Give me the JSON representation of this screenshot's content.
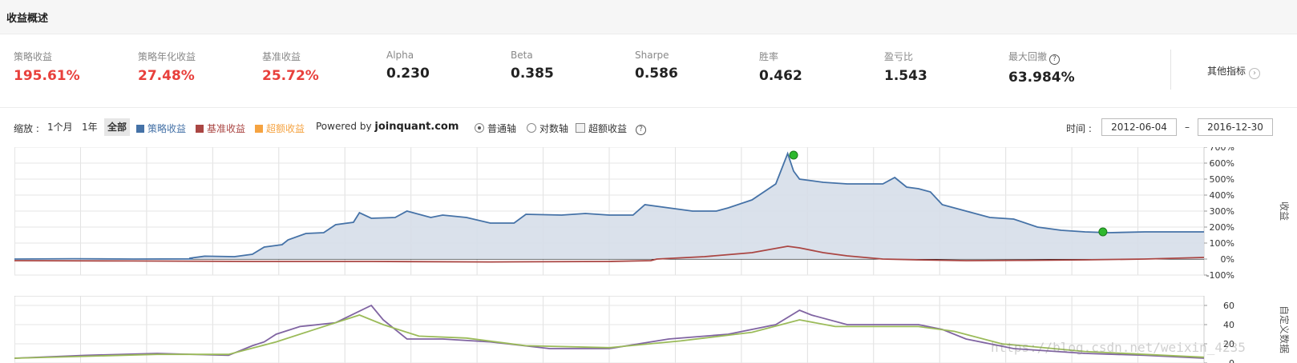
{
  "header": {
    "title": "收益概述"
  },
  "metrics": [
    {
      "label": "策略收益",
      "value": "195.61%",
      "color": "red"
    },
    {
      "label": "策略年化收益",
      "value": "27.48%",
      "color": "red"
    },
    {
      "label": "基准收益",
      "value": "25.72%",
      "color": "red"
    },
    {
      "label": "Alpha",
      "value": "0.230",
      "color": "dark"
    },
    {
      "label": "Beta",
      "value": "0.385",
      "color": "dark"
    },
    {
      "label": "Sharpe",
      "value": "0.586",
      "color": "dark"
    },
    {
      "label": "胜率",
      "value": "0.462",
      "color": "dark"
    },
    {
      "label": "盈亏比",
      "value": "1.543",
      "color": "dark"
    },
    {
      "label": "最大回撤",
      "value": "63.984%",
      "color": "dark",
      "help": "?"
    }
  ],
  "more": {
    "label": "其他指标",
    "icon": "chevron-right-icon"
  },
  "toolbar": {
    "zoom_label": "缩放 :",
    "zoom_options": [
      "1个月",
      "1年",
      "全部"
    ],
    "zoom_selected": "全部",
    "legend": [
      {
        "label": "策略收益",
        "color": "#4572a7"
      },
      {
        "label": "基准收益",
        "color": "#aa4643"
      },
      {
        "label": "超额收益",
        "color": "#f5a341"
      }
    ],
    "powered_prefix": "Powered by",
    "powered_brand": "joinquant.com",
    "axis_normal": "普通轴",
    "axis_log": "对数轴",
    "excess_toggle": "超额收益",
    "help": "?",
    "time_label": "时间 :",
    "date_from": "2012-06-04",
    "date_sep": "–",
    "date_to": "2016-12-30"
  },
  "chart_data": [
    {
      "type": "area",
      "ylabel": "收益",
      "ylim": [
        -100,
        700
      ],
      "yticks": [
        700,
        600,
        500,
        400,
        300,
        200,
        100,
        0,
        -100
      ],
      "ytick_labels": [
        "700%",
        "600%",
        "500%",
        "400%",
        "300%",
        "200%",
        "100%",
        "0%",
        "-100%"
      ],
      "grid": true,
      "series": [
        {
          "name": "策略收益",
          "color": "#4572a7",
          "fill": "#d6dee9",
          "points": [
            [
              0,
              0
            ],
            [
              0.05,
              2
            ],
            [
              0.1,
              0
            ],
            [
              0.15,
              1
            ],
            [
              0.147,
              5
            ],
            [
              0.16,
              18
            ],
            [
              0.185,
              15
            ],
            [
              0.2,
              30
            ],
            [
              0.21,
              75
            ],
            [
              0.225,
              90
            ],
            [
              0.23,
              120
            ],
            [
              0.245,
              160
            ],
            [
              0.26,
              165
            ],
            [
              0.27,
              215
            ],
            [
              0.285,
              230
            ],
            [
              0.29,
              290
            ],
            [
              0.3,
              255
            ],
            [
              0.32,
              260
            ],
            [
              0.33,
              300
            ],
            [
              0.35,
              260
            ],
            [
              0.36,
              275
            ],
            [
              0.38,
              260
            ],
            [
              0.4,
              225
            ],
            [
              0.42,
              225
            ],
            [
              0.43,
              280
            ],
            [
              0.46,
              275
            ],
            [
              0.48,
              285
            ],
            [
              0.5,
              275
            ],
            [
              0.52,
              275
            ],
            [
              0.53,
              340
            ],
            [
              0.55,
              320
            ],
            [
              0.57,
              300
            ],
            [
              0.59,
              300
            ],
            [
              0.6,
              320
            ],
            [
              0.62,
              370
            ],
            [
              0.64,
              470
            ],
            [
              0.65,
              660
            ],
            [
              0.655,
              550
            ],
            [
              0.66,
              500
            ],
            [
              0.68,
              480
            ],
            [
              0.7,
              470
            ],
            [
              0.73,
              470
            ],
            [
              0.74,
              510
            ],
            [
              0.75,
              450
            ],
            [
              0.76,
              440
            ],
            [
              0.77,
              420
            ],
            [
              0.78,
              340
            ],
            [
              0.8,
              300
            ],
            [
              0.82,
              260
            ],
            [
              0.84,
              250
            ],
            [
              0.86,
              200
            ],
            [
              0.88,
              180
            ],
            [
              0.9,
              170
            ],
            [
              0.92,
              165
            ],
            [
              0.95,
              170
            ],
            [
              1.0,
              170
            ]
          ]
        },
        {
          "name": "基准收益",
          "color": "#aa4643",
          "points": [
            [
              0,
              -10
            ],
            [
              0.1,
              -12
            ],
            [
              0.2,
              -15
            ],
            [
              0.3,
              -15
            ],
            [
              0.4,
              -18
            ],
            [
              0.5,
              -15
            ],
            [
              0.535,
              -10
            ],
            [
              0.54,
              0
            ],
            [
              0.58,
              15
            ],
            [
              0.62,
              40
            ],
            [
              0.65,
              80
            ],
            [
              0.66,
              70
            ],
            [
              0.68,
              40
            ],
            [
              0.7,
              20
            ],
            [
              0.73,
              0
            ],
            [
              0.76,
              -5
            ],
            [
              0.8,
              -10
            ],
            [
              0.85,
              -8
            ],
            [
              0.9,
              -5
            ],
            [
              0.95,
              0
            ],
            [
              1.0,
              10
            ]
          ]
        }
      ],
      "markers": [
        {
          "x": 0.655,
          "y": 650,
          "color": "#2eb82e"
        },
        {
          "x": 0.915,
          "y": 170,
          "color": "#2eb82e"
        }
      ]
    },
    {
      "type": "line",
      "ylabel": "自定义数据",
      "ylim": [
        0,
        70
      ],
      "yticks": [
        60,
        40,
        20,
        0
      ],
      "ytick_labels": [
        "60",
        "40",
        "20",
        "0"
      ],
      "grid": true,
      "series": [
        {
          "name": "",
          "color": "#8064a2",
          "points": [
            [
              0,
              5
            ],
            [
              0.06,
              8
            ],
            [
              0.12,
              10
            ],
            [
              0.18,
              8
            ],
            [
              0.2,
              18
            ],
            [
              0.21,
              22
            ],
            [
              0.22,
              30
            ],
            [
              0.24,
              38
            ],
            [
              0.27,
              42
            ],
            [
              0.3,
              60
            ],
            [
              0.31,
              45
            ],
            [
              0.33,
              25
            ],
            [
              0.36,
              25
            ],
            [
              0.4,
              22
            ],
            [
              0.45,
              15
            ],
            [
              0.5,
              15
            ],
            [
              0.55,
              25
            ],
            [
              0.6,
              30
            ],
            [
              0.64,
              40
            ],
            [
              0.66,
              55
            ],
            [
              0.67,
              50
            ],
            [
              0.7,
              40
            ],
            [
              0.76,
              40
            ],
            [
              0.78,
              35
            ],
            [
              0.8,
              25
            ],
            [
              0.84,
              15
            ],
            [
              0.9,
              10
            ],
            [
              0.95,
              8
            ],
            [
              1.0,
              5
            ]
          ]
        },
        {
          "name": "",
          "color": "#9bbb59",
          "points": [
            [
              0,
              5
            ],
            [
              0.06,
              7
            ],
            [
              0.12,
              9
            ],
            [
              0.18,
              9
            ],
            [
              0.22,
              22
            ],
            [
              0.25,
              34
            ],
            [
              0.29,
              50
            ],
            [
              0.31,
              40
            ],
            [
              0.34,
              28
            ],
            [
              0.38,
              26
            ],
            [
              0.43,
              18
            ],
            [
              0.5,
              16
            ],
            [
              0.56,
              23
            ],
            [
              0.62,
              32
            ],
            [
              0.66,
              45
            ],
            [
              0.69,
              38
            ],
            [
              0.76,
              38
            ],
            [
              0.79,
              33
            ],
            [
              0.83,
              20
            ],
            [
              0.9,
              12
            ],
            [
              1.0,
              6
            ]
          ]
        }
      ]
    }
  ],
  "watermark": "https://blog.csdn.net/weixin_4235"
}
